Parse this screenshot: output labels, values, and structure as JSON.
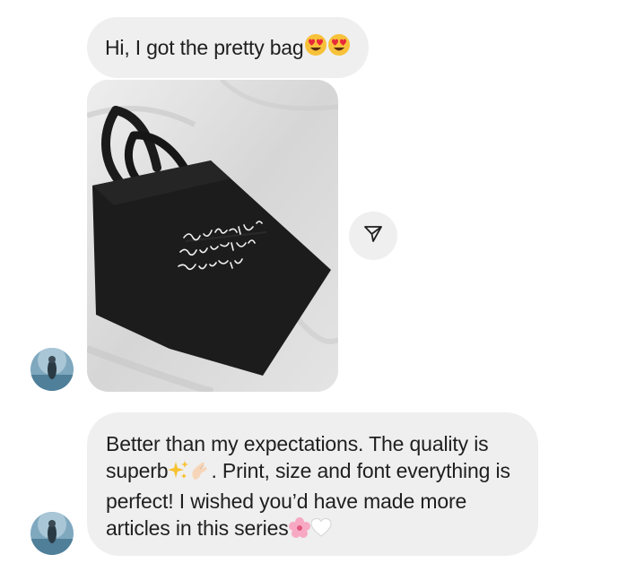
{
  "messages": [
    {
      "text": "Hi, I got the pretty bag",
      "emojis": [
        "heart-eyes-face",
        "heart-eyes-face"
      ]
    },
    {
      "type": "image",
      "icons": [
        "paper-plane-share-icon"
      ]
    },
    {
      "text_parts": [
        "Better than my expectations. The quality is superb",
        ". Print, size and font everything is perfect! I wished you’d have made more articles in this series"
      ],
      "emojis": [
        "sparkles",
        "pinching-hand",
        "cherry-blossom",
        "white-heart"
      ]
    }
  ],
  "colors": {
    "bubble_background": "#efefef",
    "text": "#1f1f1f",
    "page_background": "#ffffff"
  }
}
